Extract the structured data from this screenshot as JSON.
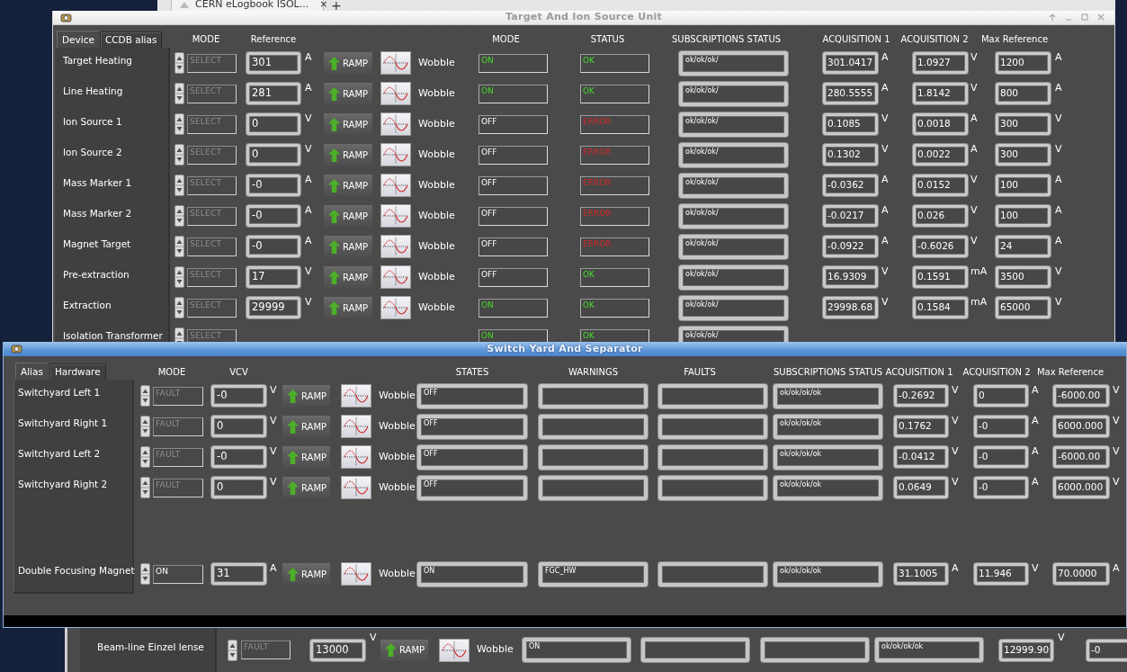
{
  "browser_tab": {
    "title": "CERN eLogbook ISOL...",
    "close": "×",
    "new_tab": "+"
  },
  "target_window": {
    "title": "Target And Ion Source Unit",
    "tabs": [
      {
        "label": "Device",
        "selected": true
      },
      {
        "label": "CCDB alias",
        "selected": false
      }
    ],
    "headers": {
      "mode": "MODE",
      "reference": "Reference",
      "state": "MODE",
      "status": "STATUS",
      "subscriptions": "SUBSCRIPTIONS STATUS",
      "acquisition_1": "ACQUISITION 1",
      "acquisition_2": "ACQUISITION 2",
      "max_reference": "Max Reference"
    },
    "rows": [
      {
        "name": "Target Heating",
        "mode": "SELECT",
        "mode_disabled": true,
        "reference": "301",
        "reference_unit": "A",
        "ramp": "RAMP",
        "wobble": "Wobble",
        "state": "ON",
        "state_on": true,
        "status": "OK",
        "status_error": false,
        "subscriptions": "ok/ok/ok/",
        "acquisition_1": "301.0417",
        "acquisition_1_unit": "A",
        "acquisition_2": "1.0927",
        "acquisition_2_unit": "V",
        "max_reference": "1200",
        "max_reference_unit": "A"
      },
      {
        "name": "Line Heating",
        "mode": "SELECT",
        "mode_disabled": true,
        "reference": "281",
        "reference_unit": "A",
        "ramp": "RAMP",
        "wobble": "Wobble",
        "state": "ON",
        "state_on": true,
        "status": "OK",
        "status_error": false,
        "subscriptions": "ok/ok/ok/",
        "acquisition_1": "280.5555",
        "acquisition_1_unit": "A",
        "acquisition_2": "1.8142",
        "acquisition_2_unit": "V",
        "max_reference": "800",
        "max_reference_unit": "A"
      },
      {
        "name": "Ion Source 1",
        "mode": "SELECT",
        "mode_disabled": true,
        "reference": "0",
        "reference_unit": "V",
        "ramp": "RAMP",
        "wobble": "Wobble",
        "state": "OFF",
        "state_on": false,
        "status": "ERROR",
        "status_error": true,
        "subscriptions": "ok/ok/ok/",
        "acquisition_1": "0.1085",
        "acquisition_1_unit": "V",
        "acquisition_2": "0.0018",
        "acquisition_2_unit": "A",
        "max_reference": "300",
        "max_reference_unit": "V"
      },
      {
        "name": "Ion Source 2",
        "mode": "SELECT",
        "mode_disabled": true,
        "reference": "0",
        "reference_unit": "V",
        "ramp": "RAMP",
        "wobble": "Wobble",
        "state": "OFF",
        "state_on": false,
        "status": "ERROR",
        "status_error": true,
        "subscriptions": "ok/ok/ok/",
        "acquisition_1": "0.1302",
        "acquisition_1_unit": "V",
        "acquisition_2": "0.0022",
        "acquisition_2_unit": "A",
        "max_reference": "300",
        "max_reference_unit": "V"
      },
      {
        "name": "Mass Marker 1",
        "mode": "SELECT",
        "mode_disabled": true,
        "reference": "-0",
        "reference_unit": "A",
        "ramp": "RAMP",
        "wobble": "Wobble",
        "state": "OFF",
        "state_on": false,
        "status": "ERROR",
        "status_error": true,
        "subscriptions": "ok/ok/ok/",
        "acquisition_1": "-0.0362",
        "acquisition_1_unit": "A",
        "acquisition_2": "0.0152",
        "acquisition_2_unit": "V",
        "max_reference": "100",
        "max_reference_unit": "A"
      },
      {
        "name": "Mass Marker 2",
        "mode": "SELECT",
        "mode_disabled": true,
        "reference": "-0",
        "reference_unit": "A",
        "ramp": "RAMP",
        "wobble": "Wobble",
        "state": "OFF",
        "state_on": false,
        "status": "ERROR",
        "status_error": true,
        "subscriptions": "ok/ok/ok/",
        "acquisition_1": "-0.0217",
        "acquisition_1_unit": "A",
        "acquisition_2": "0.026",
        "acquisition_2_unit": "V",
        "max_reference": "100",
        "max_reference_unit": "A"
      },
      {
        "name": "Magnet Target",
        "mode": "SELECT",
        "mode_disabled": true,
        "reference": "-0",
        "reference_unit": "A",
        "ramp": "RAMP",
        "wobble": "Wobble",
        "state": "OFF",
        "state_on": false,
        "status": "ERROR",
        "status_error": true,
        "subscriptions": "ok/ok/ok/",
        "acquisition_1": "-0.0922",
        "acquisition_1_unit": "A",
        "acquisition_2": "-0.6026",
        "acquisition_2_unit": "V",
        "max_reference": "24",
        "max_reference_unit": "A"
      },
      {
        "name": "Pre-extraction",
        "mode": "SELECT",
        "mode_disabled": true,
        "reference": "17",
        "reference_unit": "V",
        "ramp": "RAMP",
        "wobble": "Wobble",
        "state": "OFF",
        "state_on": false,
        "status": "OK",
        "status_error": false,
        "subscriptions": "ok/ok/ok/",
        "acquisition_1": "16.9309",
        "acquisition_1_unit": "V",
        "acquisition_2": "0.1591",
        "acquisition_2_unit": "mA",
        "max_reference": "3500",
        "max_reference_unit": "V"
      },
      {
        "name": "Extraction",
        "mode": "SELECT",
        "mode_disabled": true,
        "reference": "29999",
        "reference_unit": "V",
        "ramp": "RAMP",
        "wobble": "Wobble",
        "state": "ON",
        "state_on": true,
        "status": "OK",
        "status_error": false,
        "subscriptions": "ok/ok/ok/",
        "acquisition_1": "29998.68",
        "acquisition_1_unit": "V",
        "acquisition_2": "0.1584",
        "acquisition_2_unit": "mA",
        "max_reference": "65000",
        "max_reference_unit": "V"
      },
      {
        "name": "Isolation Transformer",
        "mode": "SELECT",
        "mode_disabled": true,
        "state": "ON",
        "state_on": true,
        "status": "OK",
        "status_error": false,
        "subscriptions": "ok/ok/ok/"
      }
    ]
  },
  "switchyard_window": {
    "title": "Switch Yard And Separator",
    "tabs": [
      {
        "label": "Alias",
        "selected": true
      },
      {
        "label": "Hardware",
        "selected": false
      }
    ],
    "headers": {
      "mode": "MODE",
      "vcv": "VCV",
      "states": "STATES",
      "warnings": "WARNINGS",
      "faults": "FAULTS",
      "subscriptions": "SUBSCRIPTIONS STATUS",
      "acquisition_1": "ACQUISITION 1",
      "acquisition_2": "ACQUISITION 2",
      "max_reference": "Max Reference"
    },
    "groups": [
      [
        {
          "name": "Switchyard Left 1",
          "mode": "FAULT",
          "mode_disabled": true,
          "vcv": "-0",
          "vcv_unit": "V",
          "ramp": "RAMP",
          "wobble": "Wobble",
          "states": "OFF",
          "subscriptions": "ok/ok/ok/ok",
          "acquisition_1": "-0.2692",
          "acquisition_1_unit": "V",
          "acquisition_2": "0",
          "acquisition_2_unit": "A",
          "max_reference": "-6000.00",
          "max_reference_unit": "V"
        },
        {
          "name": "Switchyard Right 1",
          "mode": "FAULT",
          "mode_disabled": true,
          "vcv": "0",
          "vcv_unit": "V",
          "ramp": "RAMP",
          "wobble": "Wobble",
          "states": "OFF",
          "subscriptions": "ok/ok/ok/ok",
          "acquisition_1": "0.1762",
          "acquisition_1_unit": "V",
          "acquisition_2": "-0",
          "acquisition_2_unit": "A",
          "max_reference": "6000.000",
          "max_reference_unit": "V"
        },
        {
          "name": "Switchyard Left 2",
          "mode": "FAULT",
          "mode_disabled": true,
          "vcv": "-0",
          "vcv_unit": "V",
          "ramp": "RAMP",
          "wobble": "Wobble",
          "states": "OFF",
          "subscriptions": "ok/ok/ok/ok",
          "acquisition_1": "-0.0412",
          "acquisition_1_unit": "V",
          "acquisition_2": "-0",
          "acquisition_2_unit": "A",
          "max_reference": "-6000.00",
          "max_reference_unit": "V"
        },
        {
          "name": "Switchyard Right 2",
          "mode": "FAULT",
          "mode_disabled": true,
          "vcv": "0",
          "vcv_unit": "V",
          "ramp": "RAMP",
          "wobble": "Wobble",
          "states": "OFF",
          "subscriptions": "ok/ok/ok/ok",
          "acquisition_1": "0.0649",
          "acquisition_1_unit": "V",
          "acquisition_2": "-0",
          "acquisition_2_unit": "A",
          "max_reference": "6000.000",
          "max_reference_unit": "V"
        }
      ],
      [
        {
          "name": "Double Focusing Magnet",
          "mode": "ON",
          "mode_disabled": false,
          "vcv": "31",
          "vcv_unit": "A",
          "ramp": "RAMP",
          "wobble": "Wobble",
          "states": "ON",
          "warnings": "FGC_HW",
          "subscriptions": "ok/ok/ok/ok",
          "acquisition_1": "31.1005",
          "acquisition_1_unit": "A",
          "acquisition_2": "11.946",
          "acquisition_2_unit": "V",
          "max_reference": "70.0000",
          "max_reference_unit": "A"
        }
      ]
    ]
  },
  "lower_window": {
    "rows": [
      {
        "name": "Beam-line Einzel lense",
        "mode": "FAULT",
        "mode_disabled": true,
        "reference": "13000",
        "reference_unit": "V",
        "ramp": "RAMP",
        "wobble": "Wobble",
        "state": "ON",
        "subscriptions": "ok/ok/ok/ok",
        "acquisition_1": "12999.90",
        "acquisition_1_unit": "V",
        "acquisition_2": "-0"
      }
    ]
  }
}
